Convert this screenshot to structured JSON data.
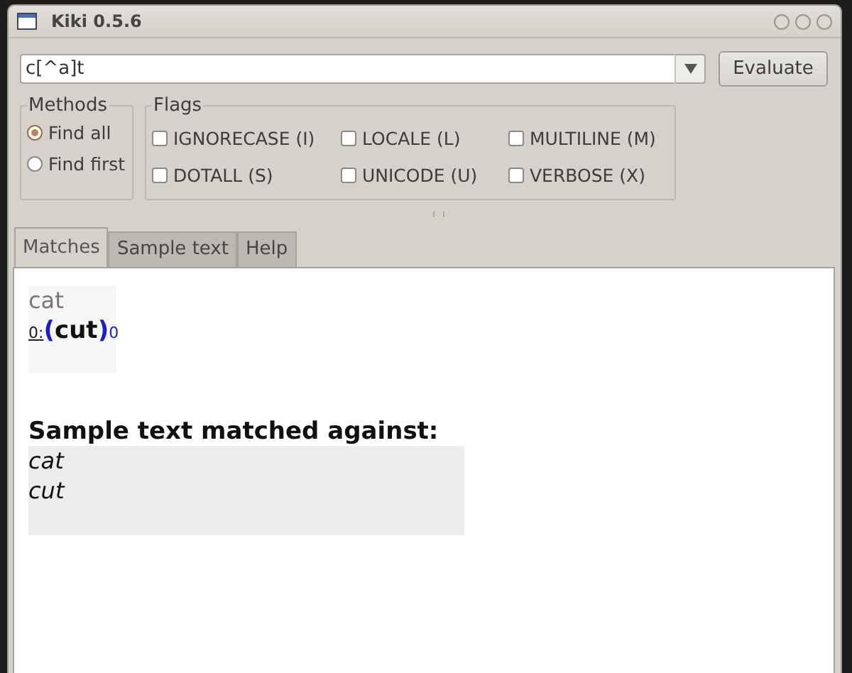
{
  "window": {
    "title": "Kiki 0.5.6"
  },
  "regex": {
    "value": "c[^a]t"
  },
  "evaluate_button": "Evaluate",
  "methods": {
    "title": "Methods",
    "options": [
      {
        "label": "Find all",
        "selected": true
      },
      {
        "label": "Find first",
        "selected": false
      }
    ]
  },
  "flags": {
    "title": "Flags",
    "items": [
      {
        "label": "IGNORECASE (I)",
        "checked": false
      },
      {
        "label": "LOCALE (L)",
        "checked": false
      },
      {
        "label": "MULTILINE (M)",
        "checked": false
      },
      {
        "label": "DOTALL (S)",
        "checked": false
      },
      {
        "label": "UNICODE (U)",
        "checked": false
      },
      {
        "label": "VERBOSE (X)",
        "checked": false
      }
    ]
  },
  "tabs": [
    {
      "label": "Matches",
      "selected": true
    },
    {
      "label": "Sample text",
      "selected": false
    },
    {
      "label": "Help",
      "selected": false
    }
  ],
  "results": [
    {
      "kind": "plain",
      "text": "cat"
    },
    {
      "kind": "match",
      "prefix": "0:",
      "open": "(",
      "text": "cut",
      "close": ")",
      "group": "0"
    }
  ],
  "sample": {
    "heading": "Sample text matched against:",
    "lines": [
      "cat",
      "cut"
    ]
  }
}
